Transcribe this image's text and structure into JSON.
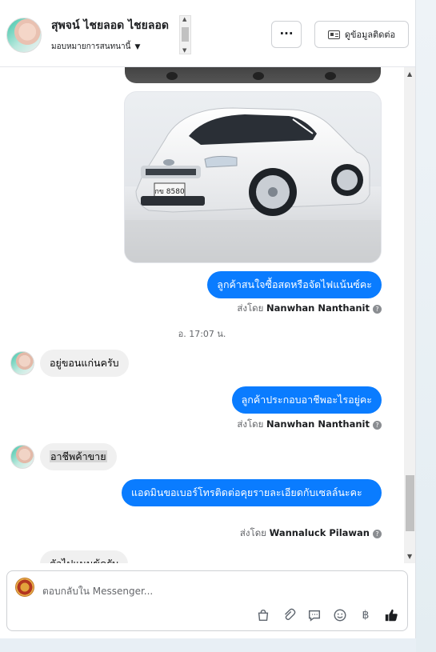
{
  "header": {
    "contact_name": "สุพจน์ ไชยลอด ไชยลอด",
    "assign_label": "มอบหมายการสนทนานี้",
    "more_label": "···",
    "contact_info_label": "ดูข้อมูลติดต่อ"
  },
  "thread": {
    "messages": [
      {
        "direction": "out",
        "text": "ลูกค้าสนใจซื้อสดหรือจัดไฟแน้นซ์คะ",
        "sent_by_prefix": "ส่งโดย",
        "sent_by": "Nanwhan Nanthanit"
      },
      {
        "type": "timestamp",
        "text": "อ. 17:07 น."
      },
      {
        "direction": "in",
        "text": "อยู่ขอนแก่นครับ"
      },
      {
        "direction": "out",
        "text": "ลูกค้าประกอบอาชีพอะไรอยู่คะ",
        "sent_by_prefix": "ส่งโดย",
        "sent_by": "Nanwhan Nanthanit"
      },
      {
        "direction": "in",
        "text": "อาชีพค้าขาย"
      },
      {
        "direction": "out",
        "text": "แอดมินขอเบอร์โทรติดต่อคุยรายละเอียดกับเซลล์นะคะ",
        "sent_by_prefix": "ส่งโดย",
        "sent_by": "Wannaluck Pilawan"
      },
      {
        "direction": "in",
        "text": "ตัวไปแนนข้ครับ"
      }
    ],
    "car_plate": "กข 8580"
  },
  "composer": {
    "placeholder": "ตอบกลับใน Messenger..."
  },
  "colors": {
    "outgoing_bubble": "#0a7cff",
    "incoming_bubble": "#f0f0f0",
    "accent": "#0a7cff"
  },
  "icons": [
    "shopping-bag-icon",
    "paperclip-icon",
    "saved-reply-icon",
    "emoji-icon",
    "baht-icon",
    "thumbs-up-icon",
    "id-card-icon",
    "info-icon",
    "caret-down-icon"
  ]
}
